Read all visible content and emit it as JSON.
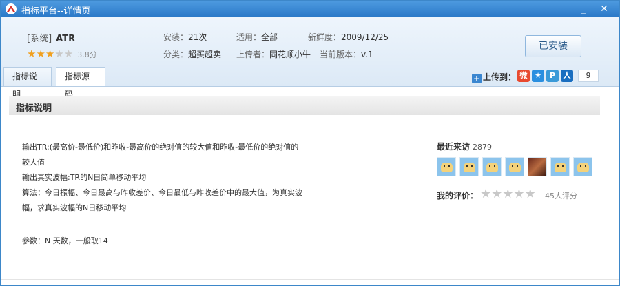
{
  "window": {
    "title": "指标平台--详情页"
  },
  "header": {
    "system_tag": "[系统]",
    "app_name": "ATR",
    "rating": {
      "value": 3,
      "max": 5,
      "score_text": "3.8分"
    },
    "info": {
      "installs_label": "安装：",
      "installs": "21次",
      "applies_label": "适用：",
      "applies": "全部",
      "freshness_label": "新鲜度：",
      "freshness": "2009/12/25",
      "category_label": "分类：",
      "category": "超买超卖",
      "uploader_label": "上传者：",
      "uploader": "同花顺小牛",
      "version_label": "当前版本：",
      "version": "v.1"
    },
    "install_button": "已安装"
  },
  "tabs": [
    {
      "label": "指标说明",
      "active": false
    },
    {
      "label": "指标源码",
      "active": true
    }
  ],
  "upload": {
    "label": "上传到：",
    "count": "9"
  },
  "section": {
    "title": "指标说明"
  },
  "description": {
    "lines": [
      "输出TR:(最高价-最低价)和昨收-最高价的绝对值的较大值和昨收-最低价的绝对值的",
      "较大值",
      "输出真实波幅:TR的N日简单移动平均",
      "算法：今日振幅、今日最高与昨收差价、今日最低与昨收差价中的最大值，为真实波",
      "幅，求真实波幅的N日移动平均"
    ],
    "params": "参数：N  天数，一般取14"
  },
  "visits": {
    "title": "最近来访",
    "count": "2879"
  },
  "my_rating": {
    "label": "我的评价：",
    "count_text": "45人评分"
  },
  "colors": {
    "accent": "#2a78c7",
    "star": "#f0a020",
    "star_off": "#c8c8c8"
  }
}
